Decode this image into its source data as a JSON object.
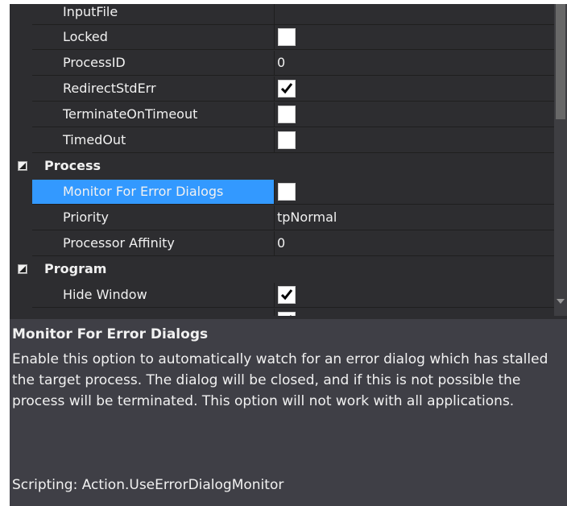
{
  "grid": {
    "rows": [
      {
        "type": "prop",
        "name": "InputFile",
        "value": ""
      },
      {
        "type": "prop",
        "name": "Locked",
        "checkbox": false
      },
      {
        "type": "prop",
        "name": "ProcessID",
        "value": "0"
      },
      {
        "type": "prop",
        "name": "RedirectStdErr",
        "checkbox": true
      },
      {
        "type": "prop",
        "name": "TerminateOnTimeout",
        "checkbox": false
      },
      {
        "type": "prop",
        "name": "TimedOut",
        "checkbox": false
      },
      {
        "type": "cat",
        "name": "Process"
      },
      {
        "type": "prop",
        "name": "Monitor For Error Dialogs",
        "checkbox": false,
        "selected": true
      },
      {
        "type": "prop",
        "name": "Priority",
        "value": "tpNormal"
      },
      {
        "type": "prop",
        "name": "Processor Affinity",
        "value": "0"
      },
      {
        "type": "cat",
        "name": "Program"
      },
      {
        "type": "prop",
        "name": "Hide Window",
        "checkbox": true
      },
      {
        "type": "prop",
        "name": "",
        "checkbox": true
      }
    ]
  },
  "help": {
    "title": "Monitor For Error Dialogs",
    "description": "Enable this option to automatically watch for an error dialog which has stalled the target process. The dialog will be closed, and if this is not possible the process will be terminated. This option will not work with all applications.",
    "scripting": "Scripting: Action.UseErrorDialogMonitor"
  },
  "icons": {
    "checkmark": "check-icon",
    "collapse": "collapse-triangle-icon",
    "scroll_down": "scroll-down-arrow-icon"
  },
  "colors": {
    "background": "#2d2d30",
    "selection": "#3399ff",
    "help_background": "#3f3f46",
    "text": "#f1f1f1"
  }
}
